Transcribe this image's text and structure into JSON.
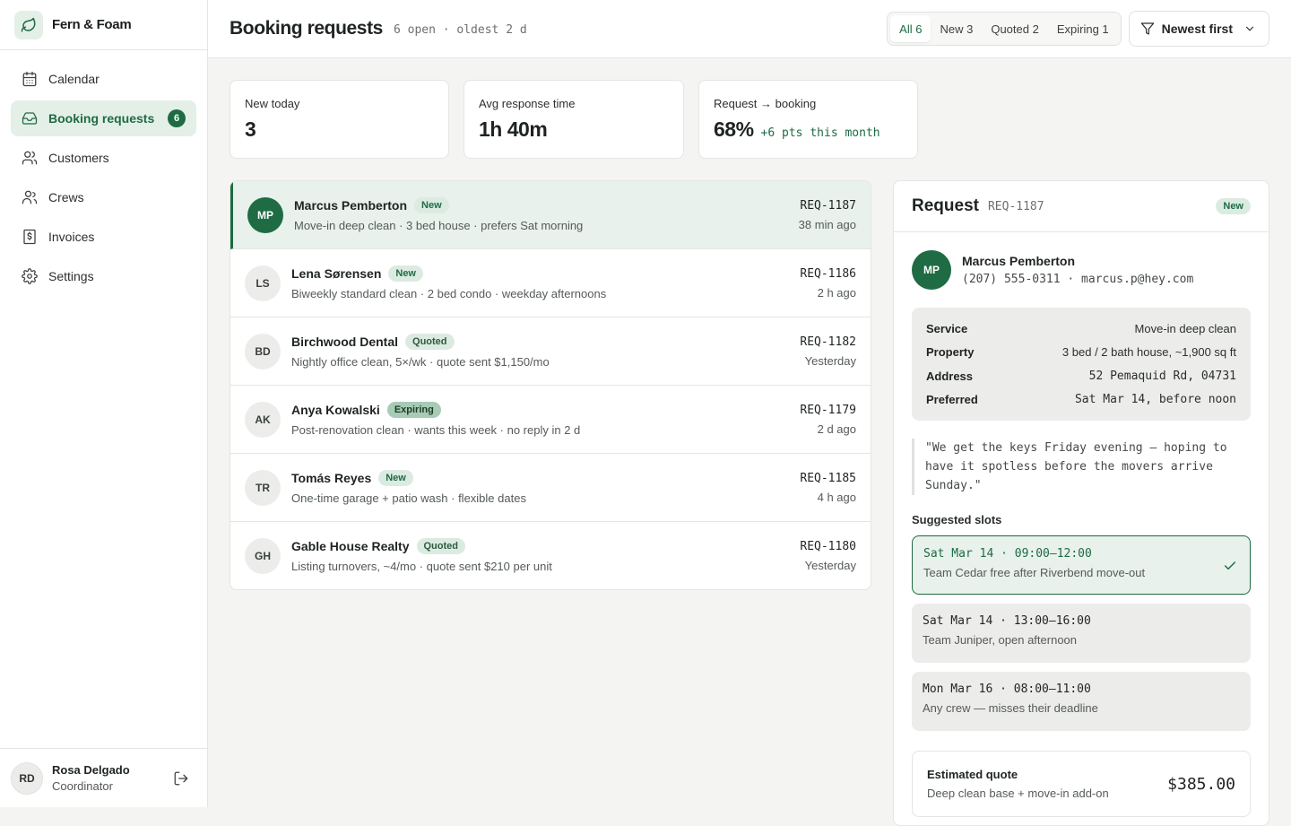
{
  "brand": {
    "name": "Fern & Foam"
  },
  "nav": [
    {
      "label": "Calendar",
      "icon": "calendar-icon"
    },
    {
      "label": "Booking requests",
      "icon": "inbox-icon",
      "badge": "6",
      "active": true
    },
    {
      "label": "Customers",
      "icon": "users-icon"
    },
    {
      "label": "Crews",
      "icon": "crew-icon"
    },
    {
      "label": "Invoices",
      "icon": "invoice-icon"
    },
    {
      "label": "Settings",
      "icon": "gear-icon"
    }
  ],
  "user": {
    "initials": "RD",
    "name": "Rosa Delgado",
    "role": "Coordinator"
  },
  "header": {
    "title": "Booking requests",
    "subtitle": "6 open · oldest 2 d",
    "tabs": [
      "All 6",
      "New 3",
      "Quoted 2",
      "Expiring 1"
    ],
    "sort": "Newest first"
  },
  "stats": [
    {
      "label": "New today",
      "value": "3",
      "delta": ""
    },
    {
      "label": "Avg response time",
      "value": "1h 40m",
      "delta": ""
    },
    {
      "label": "Request → booking",
      "value": "68%",
      "delta": "+6 pts this month"
    }
  ],
  "requests": [
    {
      "initials": "MP",
      "name": "Marcus Pemberton",
      "status": "New",
      "desc": "Move-in deep clean · 3 bed house · prefers Sat morning",
      "id": "REQ-1187",
      "time": "38 min ago"
    },
    {
      "initials": "LS",
      "name": "Lena Sørensen",
      "status": "New",
      "desc": "Biweekly standard clean · 2 bed condo · weekday afternoons",
      "id": "REQ-1186",
      "time": "2 h ago"
    },
    {
      "initials": "BD",
      "name": "Birchwood Dental",
      "status": "Quoted",
      "desc": "Nightly office clean, 5×/wk · quote sent $1,150/mo",
      "id": "REQ-1182",
      "time": "Yesterday"
    },
    {
      "initials": "AK",
      "name": "Anya Kowalski",
      "status": "Expiring",
      "desc": "Post-renovation clean · wants this week · no reply in 2 d",
      "id": "REQ-1179",
      "time": "2 d ago"
    },
    {
      "initials": "TR",
      "name": "Tomás Reyes",
      "status": "New",
      "desc": "One-time garage + patio wash · flexible dates",
      "id": "REQ-1185",
      "time": "4 h ago"
    },
    {
      "initials": "GH",
      "name": "Gable House Realty",
      "status": "Quoted",
      "desc": "Listing turnovers, ~4/mo · quote sent $210 per unit",
      "id": "REQ-1180",
      "time": "Yesterday"
    }
  ],
  "detail": {
    "title": "Request",
    "id": "REQ-1187",
    "status": "New",
    "initials": "MP",
    "name": "Marcus Pemberton",
    "contact": "(207) 555-0311 · marcus.p@hey.com",
    "info": [
      {
        "key": "Service",
        "value": "Move-in deep clean"
      },
      {
        "key": "Property",
        "value": "3 bed / 2 bath house, ~1,900 sq ft"
      },
      {
        "key": "Address",
        "value": "52 Pemaquid Rd, 04731"
      },
      {
        "key": "Preferred",
        "value": "Sat Mar 14, before noon"
      }
    ],
    "quote": "\"We get the keys Friday evening — hoping to have it spotless before the movers arrive Sunday.\"",
    "slots_label": "Suggested slots",
    "slots": [
      {
        "time": "Sat Mar 14 · 09:00–12:00",
        "note": "Team Cedar free after Riverbend move-out",
        "chosen": true
      },
      {
        "time": "Sat Mar 14 · 13:00–16:00",
        "note": "Team Juniper, open afternoon",
        "chosen": false
      },
      {
        "time": "Mon Mar 16 · 08:00–11:00",
        "note": "Any crew — misses their deadline",
        "chosen": false
      }
    ],
    "estimate_label": "Estimated quote",
    "estimate_note": "Deep clean base + move-in add-on",
    "estimate_price": "$385.00"
  }
}
